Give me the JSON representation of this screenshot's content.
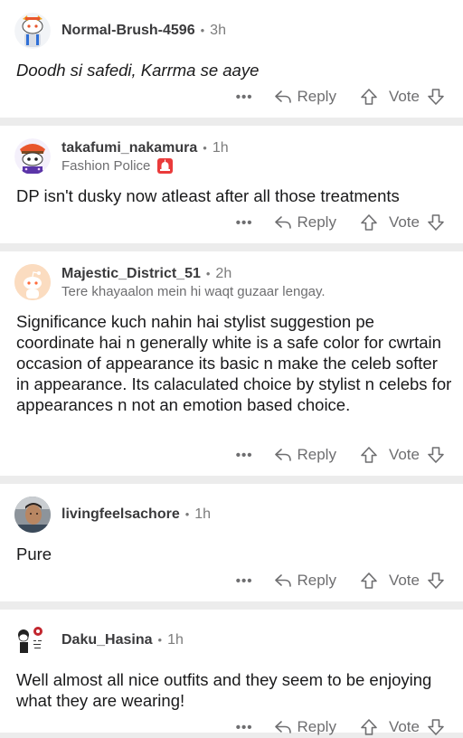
{
  "comments": [
    {
      "username": "Normal-Brush-4596",
      "age": "3h",
      "flair": "",
      "text": "Doodh si safedi, Karrma se aaye",
      "avatar_icon": "snoo-avatar-icon"
    },
    {
      "username": "takafumi_nakamura",
      "age": "1h",
      "flair": "Fashion Police",
      "flair_icon": "siren-icon",
      "text": "DP isn't dusky now atleast after all those treatments",
      "avatar_icon": "snoo-avatar-icon"
    },
    {
      "username": "Majestic_District_51",
      "age": "2h",
      "flair": "Tere khayaalon mein hi waqt guzaar lengay.",
      "text": "Significance kuch nahin hai stylist suggestion pe coordinate hai n generally white is a safe color for cwrtain occasion of appearance its basic n make the celeb softer in appearance.  Its calaculated choice by stylist n celebs for appearances n not an emotion based choice.",
      "avatar_icon": "default-snoo-icon"
    },
    {
      "username": "livingfeelsachore",
      "age": "1h",
      "flair": "",
      "text": "Pure",
      "avatar_icon": "photo-avatar-icon"
    },
    {
      "username": "Daku_Hasina",
      "age": "1h",
      "flair": "",
      "text": "Well almost all nice outfits and they seem to be enjoying what they are wearing!",
      "avatar_icon": "snoo-avatar-icon"
    }
  ],
  "actions": {
    "more": "•••",
    "reply": "Reply",
    "vote": "Vote"
  },
  "colors": {
    "background": "#ececec",
    "card": "#ffffff",
    "username": "#3a3a3c",
    "muted": "#6e6e70",
    "flair_badge": "#ea3b3b"
  }
}
